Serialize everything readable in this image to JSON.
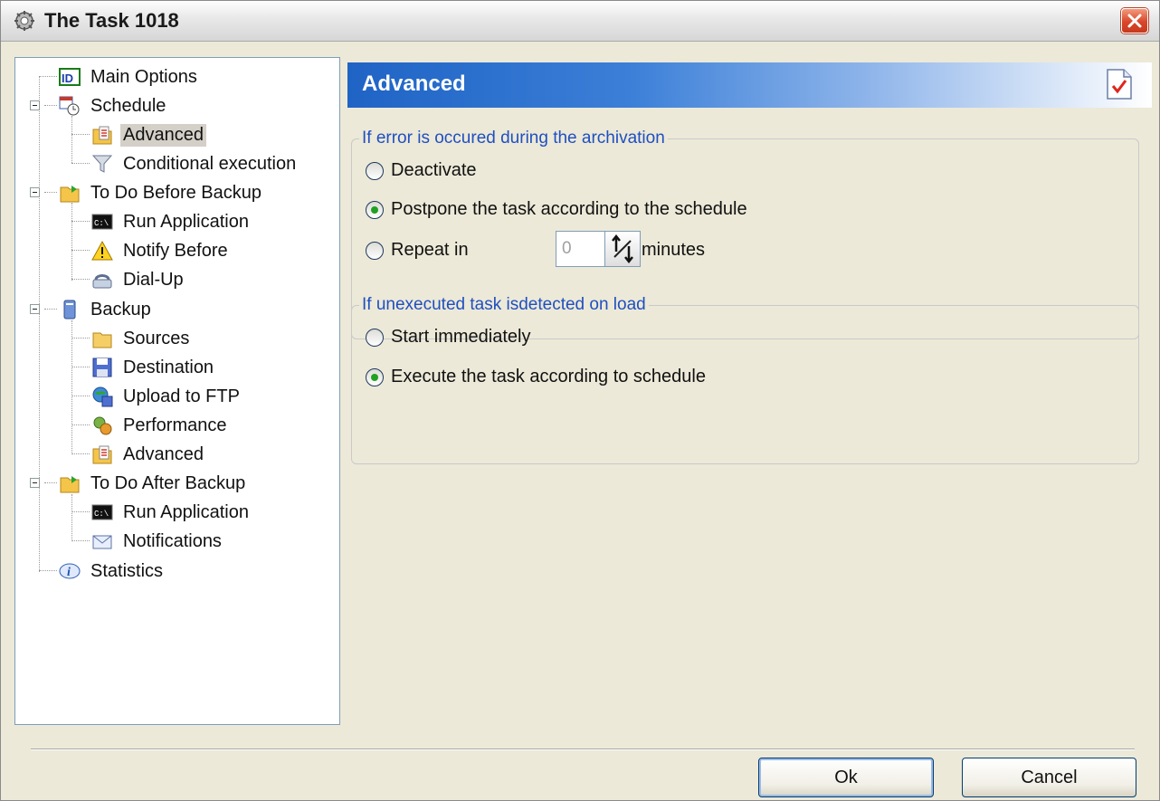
{
  "window": {
    "title": "The Task 1018"
  },
  "tree": {
    "items": [
      {
        "label": "Main Options",
        "icon": "id-icon",
        "selected": false
      },
      {
        "label": "Schedule",
        "icon": "calendar-clock-icon",
        "selected": false
      },
      {
        "label": "Advanced",
        "icon": "advanced-settings-icon",
        "selected": true
      },
      {
        "label": "Conditional execution",
        "icon": "filter-icon",
        "selected": false
      },
      {
        "label": "To Do Before Backup",
        "icon": "folder-arrow-icon",
        "selected": false
      },
      {
        "label": "Run Application",
        "icon": "console-icon",
        "selected": false
      },
      {
        "label": "Notify Before",
        "icon": "warning-icon",
        "selected": false
      },
      {
        "label": "Dial-Up",
        "icon": "dialup-icon",
        "selected": false
      },
      {
        "label": "Backup",
        "icon": "computer-icon",
        "selected": false
      },
      {
        "label": "Sources",
        "icon": "folder-icon",
        "selected": false
      },
      {
        "label": "Destination",
        "icon": "floppy-icon",
        "selected": false
      },
      {
        "label": "Upload to FTP",
        "icon": "ftp-icon",
        "selected": false
      },
      {
        "label": "Performance",
        "icon": "gears-icon",
        "selected": false
      },
      {
        "label": "Advanced",
        "icon": "advanced-settings-icon",
        "selected": false
      },
      {
        "label": "To Do After Backup",
        "icon": "folder-arrow-icon",
        "selected": false
      },
      {
        "label": "Run Application",
        "icon": "console-icon",
        "selected": false
      },
      {
        "label": "Notifications",
        "icon": "envelope-icon",
        "selected": false
      },
      {
        "label": "Statistics",
        "icon": "info-icon",
        "selected": false
      }
    ]
  },
  "panel": {
    "title": "Advanced",
    "error_group": {
      "legend": "If error is occured during the archivation",
      "options": [
        {
          "label": "Deactivate",
          "checked": false
        },
        {
          "label": "Postpone the task according to the schedule",
          "checked": true
        },
        {
          "label": "Repeat in",
          "checked": false
        }
      ],
      "repeat_value": "0",
      "repeat_unit": "minutes"
    },
    "unexecuted_group": {
      "legend": "If unexecuted task isdetected on load",
      "options": [
        {
          "label": "Start immediately",
          "checked": false
        },
        {
          "label": "Execute the task according to schedule",
          "checked": true
        }
      ]
    }
  },
  "buttons": {
    "ok": "Ok",
    "cancel": "Cancel"
  },
  "colors": {
    "header_start": "#1f63c5",
    "legend_text": "#1f4fc0",
    "selected_bg": "#d4d0c8"
  }
}
